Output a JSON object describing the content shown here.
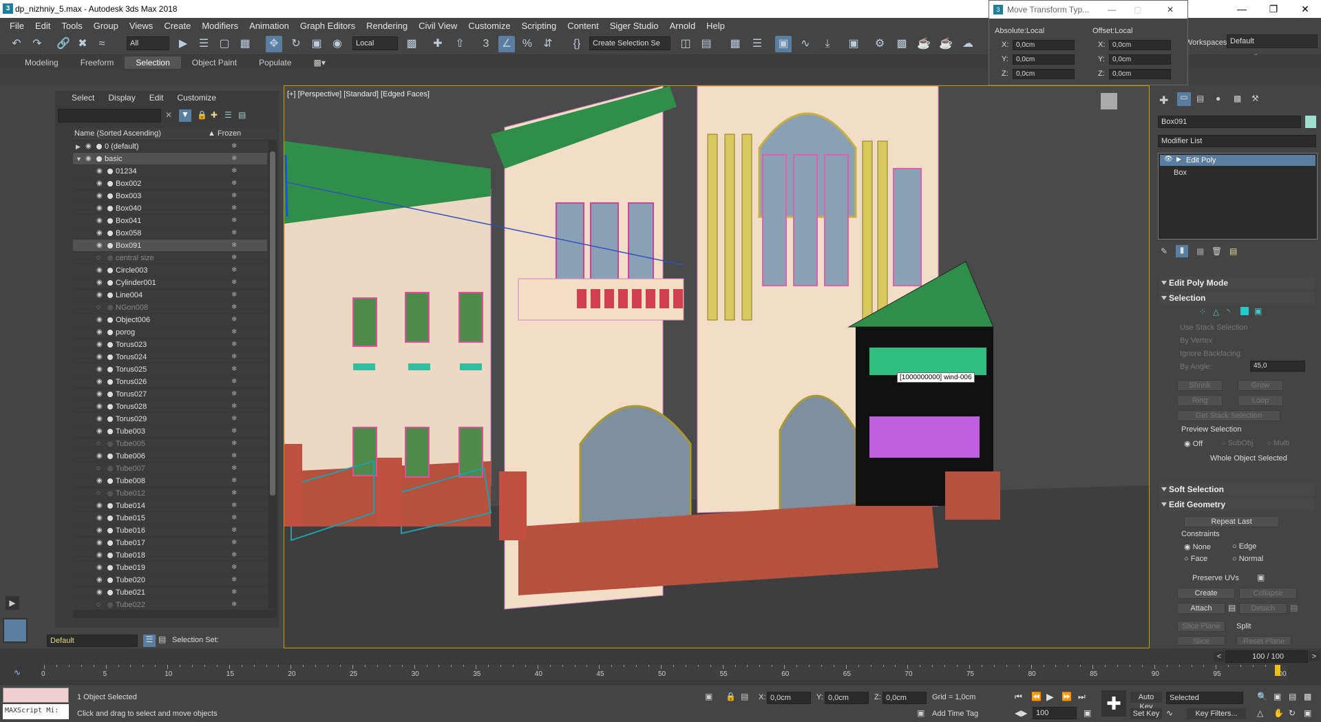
{
  "window": {
    "title": "dp_nizhniy_5.max - Autodesk 3ds Max 2018"
  },
  "menu": [
    "File",
    "Edit",
    "Tools",
    "Group",
    "Views",
    "Create",
    "Modifiers",
    "Animation",
    "Graph Editors",
    "Rendering",
    "Civil View",
    "Customize",
    "Scripting",
    "Content",
    "Siger Studio",
    "Arnold",
    "Help"
  ],
  "toolbar": {
    "filter": "All",
    "coord": "Local",
    "selection_set": "Create Selection Se",
    "workspaces_label": "Workspaces:",
    "workspace": "Default"
  },
  "ribbon": {
    "tabs": [
      "Modeling",
      "Freeform",
      "Selection",
      "Object Paint",
      "Populate"
    ],
    "active": "Selection"
  },
  "scene_explorer": {
    "menu": [
      "Select",
      "Display",
      "Edit",
      "Customize"
    ],
    "col_name": "Name (Sorted Ascending)",
    "col_frozen": "▲ Frozen",
    "rows": [
      {
        "name": "0 (default)",
        "dim": false
      },
      {
        "name": "basic",
        "dim": false
      },
      {
        "name": "01234",
        "dim": false
      },
      {
        "name": "Box002",
        "dim": false
      },
      {
        "name": "Box003",
        "dim": false
      },
      {
        "name": "Box040",
        "dim": false
      },
      {
        "name": "Box041",
        "dim": false
      },
      {
        "name": "Box058",
        "dim": false
      },
      {
        "name": "Box091",
        "dim": false
      },
      {
        "name": "central size",
        "dim": true
      },
      {
        "name": "Circle003",
        "dim": false
      },
      {
        "name": "Cylinder001",
        "dim": false
      },
      {
        "name": "Line004",
        "dim": false
      },
      {
        "name": "NGon008",
        "dim": true
      },
      {
        "name": "Object006",
        "dim": false
      },
      {
        "name": "porog",
        "dim": false
      },
      {
        "name": "Torus023",
        "dim": false
      },
      {
        "name": "Torus024",
        "dim": false
      },
      {
        "name": "Torus025",
        "dim": false
      },
      {
        "name": "Torus026",
        "dim": false
      },
      {
        "name": "Torus027",
        "dim": false
      },
      {
        "name": "Torus028",
        "dim": false
      },
      {
        "name": "Torus029",
        "dim": false
      },
      {
        "name": "Tube003",
        "dim": false
      },
      {
        "name": "Tube005",
        "dim": true
      },
      {
        "name": "Tube006",
        "dim": false
      },
      {
        "name": "Tube007",
        "dim": true
      },
      {
        "name": "Tube008",
        "dim": false
      },
      {
        "name": "Tube012",
        "dim": true
      },
      {
        "name": "Tube014",
        "dim": false
      },
      {
        "name": "Tube015",
        "dim": false
      },
      {
        "name": "Tube016",
        "dim": false
      },
      {
        "name": "Tube017",
        "dim": false
      },
      {
        "name": "Tube018",
        "dim": false
      },
      {
        "name": "Tube019",
        "dim": false
      },
      {
        "name": "Tube020",
        "dim": false
      },
      {
        "name": "Tube021",
        "dim": false
      },
      {
        "name": "Tube022",
        "dim": true
      }
    ],
    "layer": "Default",
    "selection_set_label": "Selection Set:"
  },
  "viewport": {
    "label": "[+] [Perspective] [Standard] [Edged Faces]",
    "tooltip": "[1000000000] wind-006"
  },
  "move_transform": {
    "title": "Move Transform Typ...",
    "absolute": "Absolute:Local",
    "offset": "Offset:Local",
    "x": "0,0cm",
    "y": "0,0cm",
    "z": "0,0cm",
    "ox": "0,0cm",
    "oy": "0,0cm",
    "oz": "0,0cm"
  },
  "command_panel": {
    "object_name": "Box091",
    "modifier_list": "Modifier List",
    "stack": [
      "Edit Poly",
      "Box"
    ],
    "edit_poly_mode": "Edit Poly Mode",
    "selection": "Selection",
    "use_stack": "Use Stack Selection",
    "by_vertex": "By Vertex",
    "ignore_backfacing": "Ignore Backfacing",
    "by_angle": "By Angle:",
    "angle": "45,0",
    "shrink": "Shrink",
    "grow": "Grow",
    "ring": "Ring",
    "loop": "Loop",
    "get_stack": "Get Stack Selection",
    "preview_selection": "Preview Selection",
    "off": "Off",
    "subobj": "SubObj",
    "multi": "Multi",
    "whole": "Whole Object Selected",
    "soft_selection": "Soft Selection",
    "edit_geometry": "Edit Geometry",
    "repeat_last": "Repeat Last",
    "constraints": "Constraints",
    "none": "None",
    "edge": "Edge",
    "face": "Face",
    "normal": "Normal",
    "preserve_uvs": "Preserve UVs",
    "create": "Create",
    "collapse": "Collapse",
    "attach": "Attach",
    "detach": "Detach",
    "slice_plane": "Slice Plane",
    "split": "Split",
    "slice": "Slice",
    "reset_plane": "Reset Plane"
  },
  "timeline": {
    "frame": "100 / 100",
    "ticks": [
      "0",
      "5",
      "10",
      "15",
      "20",
      "25",
      "30",
      "35",
      "40",
      "45",
      "50",
      "55",
      "60",
      "65",
      "70",
      "75",
      "80",
      "85",
      "90",
      "95",
      "100"
    ]
  },
  "status": {
    "maxscript": "MAXScript Mi:",
    "selected": "1 Object Selected",
    "prompt": "Click and drag to select and move objects",
    "x": "0,0cm",
    "y": "0,0cm",
    "z": "0,0cm",
    "grid": "Grid = 1,0cm",
    "add_time_tag": "Add Time Tag",
    "auto_key": "Auto Key",
    "set_key": "Set Key",
    "key_mode": "Selected",
    "key_filters": "Key Filters...",
    "frame": "100"
  }
}
